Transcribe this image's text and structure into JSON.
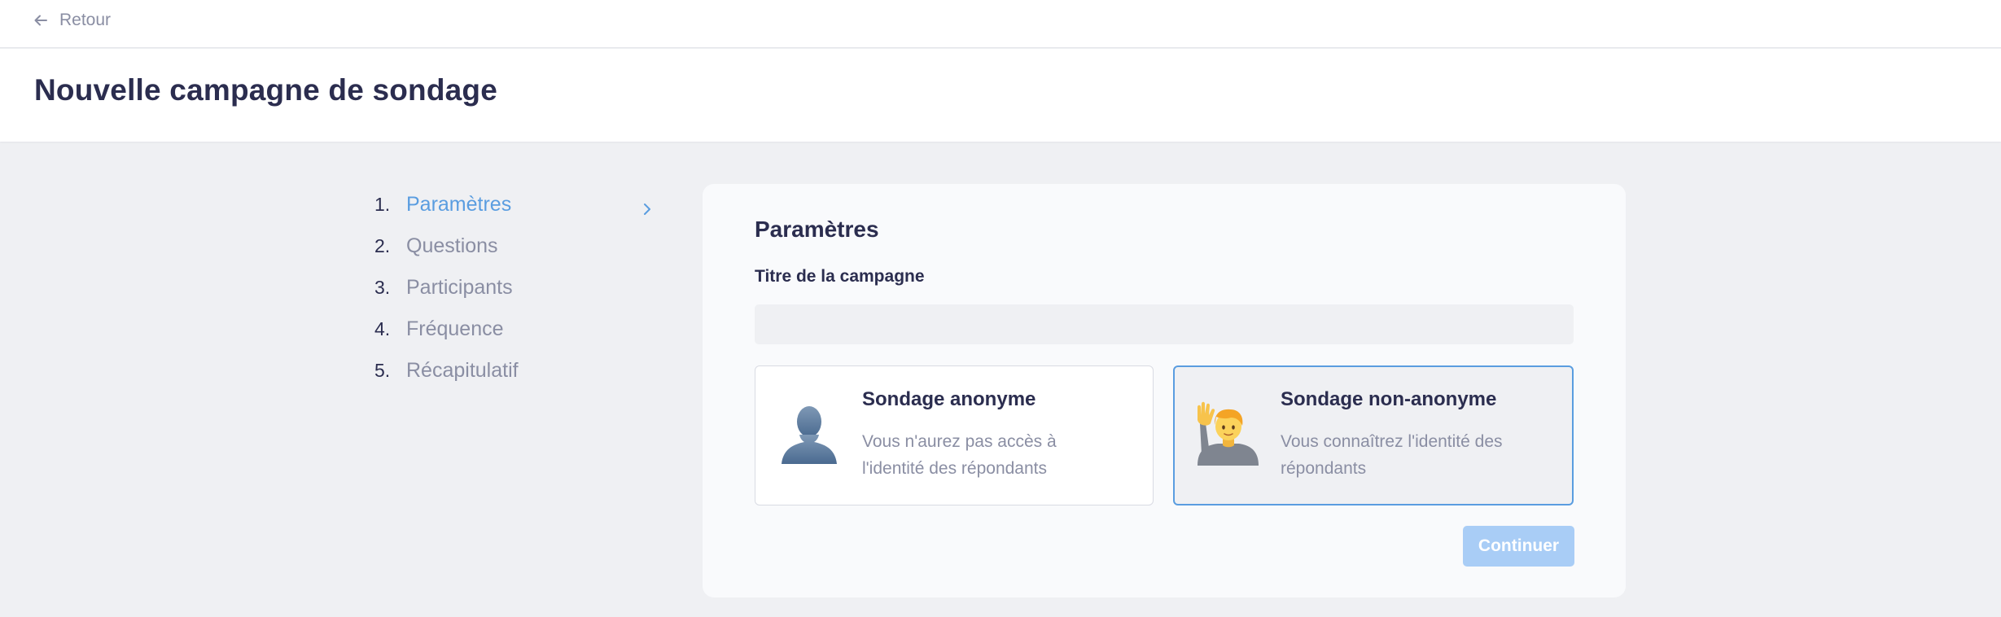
{
  "topbar": {
    "back_label": "Retour",
    "back_icon": "arrow-left-icon"
  },
  "header": {
    "title": "Nouvelle campagne de sondage"
  },
  "steps": [
    {
      "number": "1.",
      "label": "Paramètres",
      "active": true
    },
    {
      "number": "2.",
      "label": "Questions",
      "active": false
    },
    {
      "number": "3.",
      "label": "Participants",
      "active": false
    },
    {
      "number": "4.",
      "label": "Fréquence",
      "active": false
    },
    {
      "number": "5.",
      "label": "Récapitulatif",
      "active": false
    }
  ],
  "form": {
    "section_title": "Paramètres",
    "title_field": {
      "label": "Titre de la campagne",
      "value": "",
      "placeholder": ""
    },
    "options": [
      {
        "title": "Sondage anonyme",
        "description": "Vous n'aurez pas accès à l'identité des répondants",
        "icon": "bust-silhouette-icon",
        "selected": false
      },
      {
        "title": "Sondage non-anonyme",
        "description": "Vous connaîtrez l'identité des répondants",
        "icon": "person-raising-hand-icon",
        "selected": true
      }
    ],
    "continue_label": "Continuer",
    "continue_disabled": true
  },
  "colors": {
    "accent": "#5a9de0",
    "text_primary": "#2b2d4f",
    "text_muted": "#8a8ea3",
    "background": "#eff0f3",
    "button_disabled": "#a9cdf6"
  }
}
